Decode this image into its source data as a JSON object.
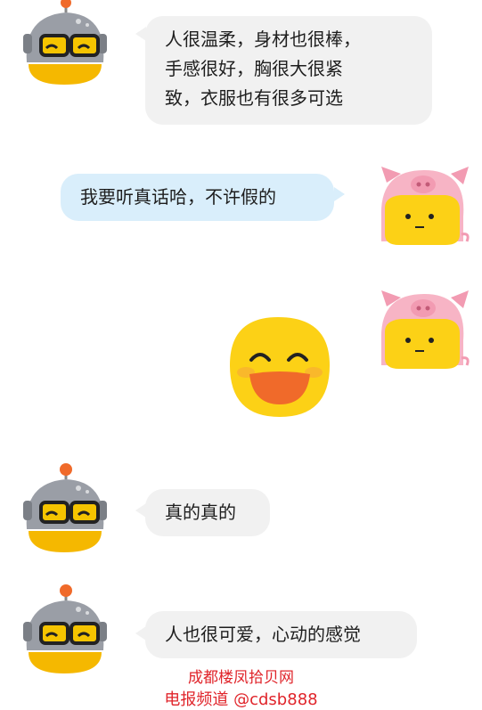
{
  "messages": [
    {
      "side": "left",
      "avatar": "robot-avatar",
      "text": "人很温柔，身材也很棒，手感很好，胸很大很紧致，衣服也有很多可选"
    },
    {
      "side": "right",
      "avatar": "pig-avatar",
      "text": "我要听真话哈，不许假的"
    },
    {
      "side": "right",
      "avatar": "pig-avatar",
      "sticker": "laughing-emoji-sticker"
    },
    {
      "side": "left",
      "avatar": "robot-avatar",
      "text": "真的真的"
    },
    {
      "side": "left",
      "avatar": "robot-avatar",
      "text": "人也很可爱，心动的感觉"
    }
  ],
  "bubbles": {
    "m1_line1": "人很温柔，身材也很棒，",
    "m1_line2": "手感很好，胸很大很紧",
    "m1_line3": "致，衣服也有很多可选",
    "m2": "我要听真话哈，不许假的",
    "m4": "真的真的",
    "m5": "人也很可爱，心动的感觉"
  },
  "watermark": {
    "line1": "成都楼凤拾贝网",
    "line2": "电报频道 @cdsb888"
  },
  "colors": {
    "left_bubble": "#f1f1f1",
    "right_bubble": "#d9eefb",
    "watermark": "#e0242a",
    "emoji_yellow": "#fcd116"
  }
}
